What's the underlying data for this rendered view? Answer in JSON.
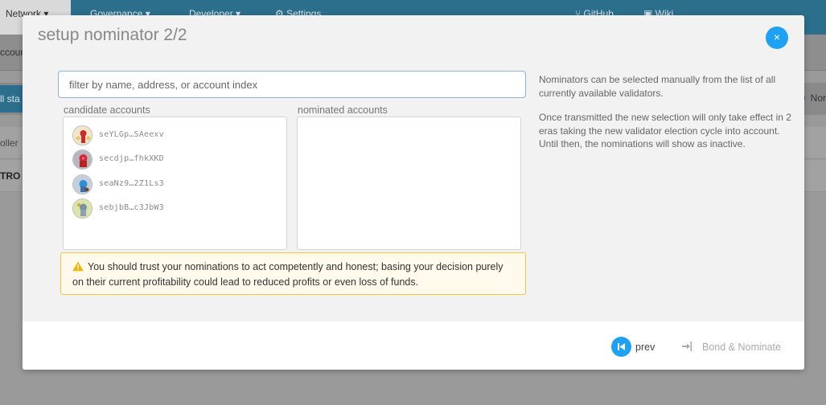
{
  "background": {
    "nav": [
      {
        "label": "Network"
      },
      {
        "label": "Governance"
      },
      {
        "label": "Developer"
      },
      {
        "label": "Settings"
      },
      {
        "label": "GitHub"
      },
      {
        "label": "Wiki"
      }
    ],
    "tab_fragment": "ccount",
    "strip_button_fragment": "ll sta",
    "strip_right_fragment": "Nor",
    "row1_fragment": "oller",
    "row2_fragment": "TRO"
  },
  "modal": {
    "title": "setup nominator 2/2",
    "close_label": "×"
  },
  "search": {
    "placeholder": "filter by name, address, or account index",
    "value": ""
  },
  "candidates": {
    "label": "candidate accounts",
    "items": [
      {
        "name": "seYLGp…SAeexv",
        "color": "#cc2b2b"
      },
      {
        "name": "secdjp…fhkXKD",
        "color": "#d32a2a"
      },
      {
        "name": "seaNz9…2Z1Ls3",
        "color": "#2f8fd6"
      },
      {
        "name": "sebjbB…c3JbW3",
        "color": "#7b8fa6"
      }
    ]
  },
  "nominated": {
    "label": "nominated accounts",
    "items": []
  },
  "warning": {
    "text": "You should trust your nominations to act competently and honest; basing your decision purely on their current profitability could lead to reduced profits or even loss of funds."
  },
  "info": {
    "p1": "Nominators can be selected manually from the list of all currently available validators.",
    "p2": "Once transmitted the new selection will only take effect in 2 eras taking the new validator election cycle into account. Until then, the nominations will show as inactive."
  },
  "footer": {
    "prev_label": "prev",
    "bond_label": "Bond & Nominate"
  },
  "colors": {
    "accent": "#1ea1f2",
    "warning_border": "#f0c640",
    "warning_bg": "#fffaeb"
  }
}
